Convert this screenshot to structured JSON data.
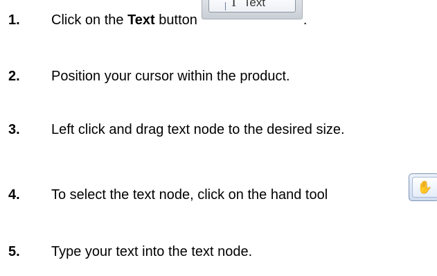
{
  "steps": [
    {
      "number": "1.",
      "prefix": "Click on the ",
      "bold": "Text",
      "suffix": " button",
      "trailing": ".",
      "button_label": "Text",
      "button_icon": "text-tool-icon"
    },
    {
      "number": "2.",
      "text": "Position your cursor within the product."
    },
    {
      "number": "3.",
      "text": "Left click and drag text node to the desired size."
    },
    {
      "number": "4.",
      "text": "To select the text node, click on the hand tool",
      "tool_icon": "hand-tool-icon"
    },
    {
      "number": "5.",
      "text": "Type your text into the text node."
    }
  ]
}
